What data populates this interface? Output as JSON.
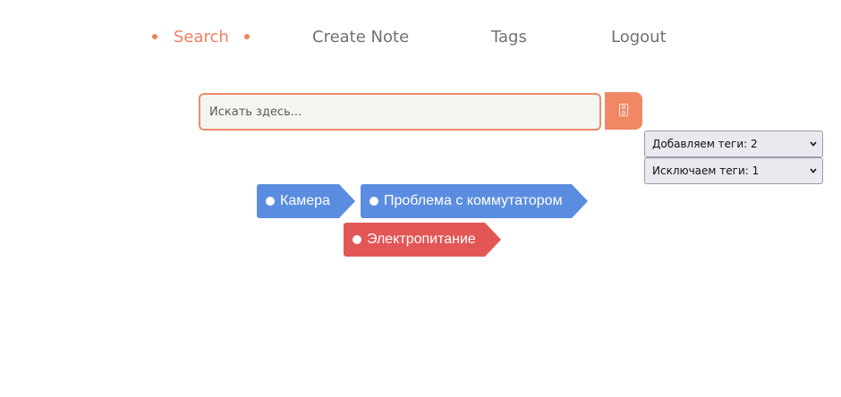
{
  "nav": {
    "items": [
      {
        "label": "Search",
        "active": true
      },
      {
        "label": "Create Note",
        "active": false
      },
      {
        "label": "Tags",
        "active": false
      },
      {
        "label": "Logout",
        "active": false
      }
    ]
  },
  "search": {
    "placeholder": "Искать здесь...",
    "value": "",
    "button_icon": "search-icon"
  },
  "filters": {
    "include_label": "Добавляем теги: 2",
    "exclude_label": "Исключаем теги: 1"
  },
  "tags": {
    "included": [
      "Камера",
      "Проблема с коммутатором"
    ],
    "excluded": [
      "Электропитание"
    ]
  },
  "colors": {
    "accent": "#f07f5f",
    "tag_include": "#5a8de0",
    "tag_exclude": "#e35656"
  }
}
